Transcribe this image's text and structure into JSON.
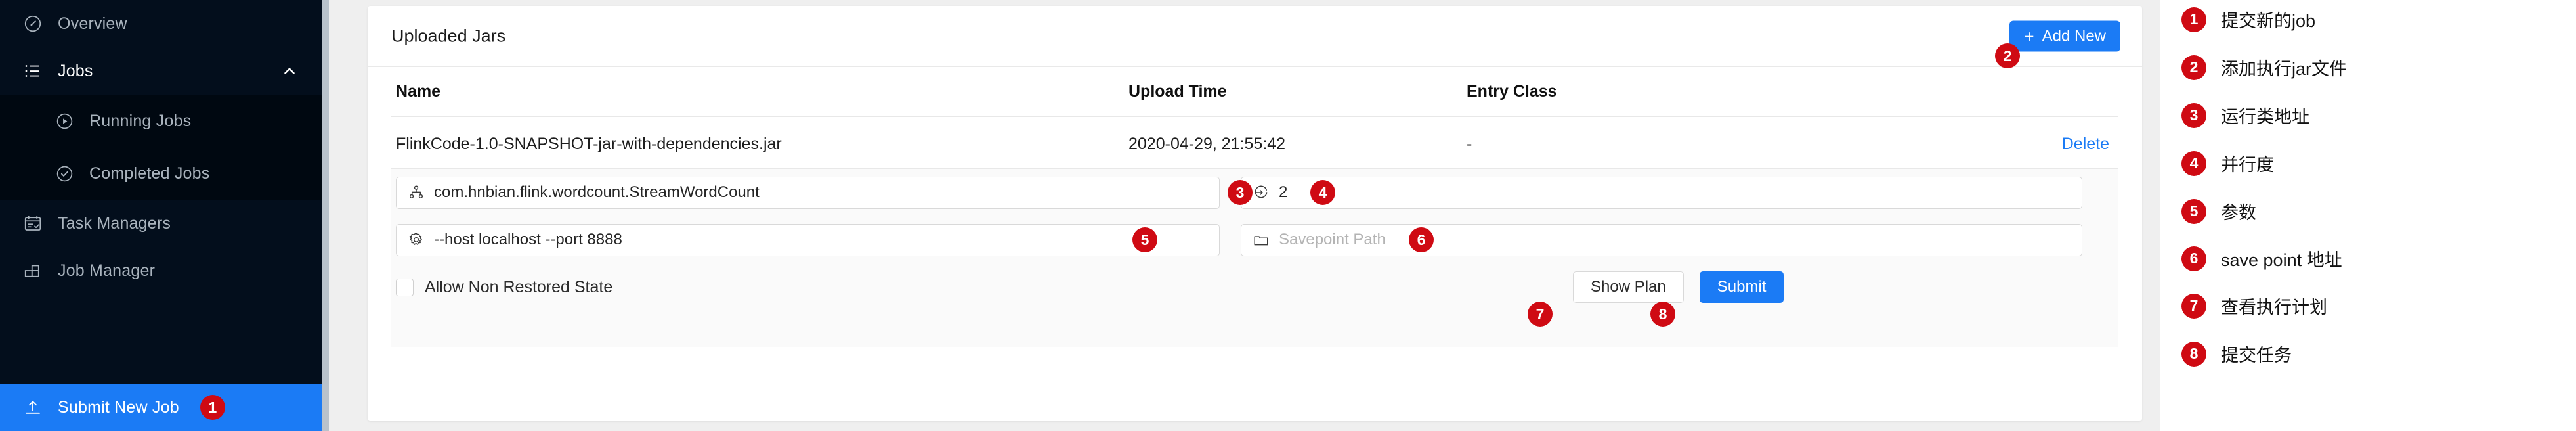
{
  "sidebar": {
    "items": [
      {
        "label": "Overview",
        "icon": "dashboard-icon",
        "level": 0,
        "state": "normal"
      },
      {
        "label": "Jobs",
        "icon": "list-icon",
        "level": 0,
        "state": "expanded",
        "chevron": "chevron-up-icon"
      },
      {
        "label": "Running Jobs",
        "icon": "play-circle-icon",
        "level": 1,
        "state": "normal"
      },
      {
        "label": "Completed Jobs",
        "icon": "check-circle-icon",
        "level": 1,
        "state": "normal"
      },
      {
        "label": "Task Managers",
        "icon": "task-board-icon",
        "level": 0,
        "state": "normal"
      },
      {
        "label": "Job Manager",
        "icon": "blocks-icon",
        "level": 0,
        "state": "normal"
      },
      {
        "label": "Submit New Job",
        "icon": "upload-icon",
        "level": 0,
        "state": "active",
        "marker": "1"
      }
    ]
  },
  "card": {
    "title": "Uploaded Jars",
    "add_new_label": "Add New",
    "add_new_marker": "2"
  },
  "table": {
    "columns": [
      "Name",
      "Upload Time",
      "Entry Class",
      ""
    ],
    "rows": [
      {
        "name": "FlinkCode-1.0-SNAPSHOT-jar-with-dependencies.jar",
        "upload_time": "2020-04-29, 21:55:42",
        "entry_class": "-",
        "action": "Delete"
      }
    ]
  },
  "form": {
    "entry_class": {
      "icon": "cluster-icon",
      "value": "com.hnbian.flink.wordcount.StreamWordCount",
      "marker": "3"
    },
    "parallelism": {
      "icon": "login-arrow-icon",
      "value": "2",
      "marker": "4"
    },
    "program_arguments": {
      "icon": "gear-icon",
      "value": "--host localhost --port 8888",
      "marker": "5"
    },
    "savepoint_path": {
      "icon": "folder-icon",
      "placeholder": "Savepoint Path",
      "value": "",
      "marker": "6"
    },
    "allow_non_restored_state": {
      "label": "Allow Non Restored State",
      "checked": false
    },
    "show_plan_label": "Show Plan",
    "show_plan_marker": "7",
    "submit_label": "Submit",
    "submit_marker": "8"
  },
  "legend": {
    "items": [
      {
        "num": "1",
        "text": "提交新的job"
      },
      {
        "num": "2",
        "text": "添加执行jar文件"
      },
      {
        "num": "3",
        "text": "运行类地址"
      },
      {
        "num": "4",
        "text": "并行度"
      },
      {
        "num": "5",
        "text": "参数"
      },
      {
        "num": "6",
        "text": "save point 地址"
      },
      {
        "num": "7",
        "text": "查看执行计划"
      },
      {
        "num": "8",
        "text": "提交任务"
      }
    ]
  },
  "colors": {
    "sidebar_bg": "#030e1c",
    "sidebar_sub_bg": "#000811",
    "accent_blue": "#1b7bf5",
    "marker_red": "#cf0a13",
    "panel_bg": "#fafafa",
    "page_bg": "#efefef"
  }
}
